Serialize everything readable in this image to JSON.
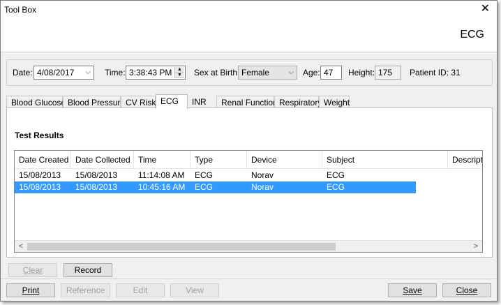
{
  "window": {
    "title": "Tool Box",
    "header_title": "ECG"
  },
  "patient": {
    "date_label": "Date:",
    "date_value": "4/08/2017",
    "time_label": "Time:",
    "time_value": "3:38:43 PM",
    "sex_label": "Sex at Birth:",
    "sex_value": "Female",
    "age_label": "Age:",
    "age_value": "47",
    "height_label": "Height:",
    "height_value": "175",
    "patient_id": "Patient ID: 31"
  },
  "tabs": [
    {
      "label": "Blood Glucose",
      "active": false
    },
    {
      "label": "Blood Pressure",
      "active": false
    },
    {
      "label": "CV Risk",
      "active": false
    },
    {
      "label": "ECG",
      "active": true
    },
    {
      "label": "INR",
      "active": false
    },
    {
      "label": "Renal Function",
      "active": false
    },
    {
      "label": "Respiratory",
      "active": false
    },
    {
      "label": "Weight",
      "active": false
    }
  ],
  "results": {
    "section_title": "Test Results",
    "columns": [
      "Date Created",
      "Date Collected",
      "Time",
      "Type",
      "Device",
      "Subject",
      "Descripti"
    ],
    "rows": [
      {
        "cells": [
          "15/08/2013",
          "15/08/2013",
          "11:14:08 AM",
          "ECG",
          "Norav",
          "ECG"
        ],
        "selected": false
      },
      {
        "cells": [
          "15/08/2013",
          "15/08/2013",
          "10:45:16 AM",
          "ECG",
          "Norav",
          "ECG"
        ],
        "selected": true
      }
    ]
  },
  "actions": {
    "clear": "Clear",
    "record": "Record"
  },
  "footer": {
    "print": "Print",
    "reference": "Reference",
    "edit": "Edit",
    "view": "View",
    "save": "Save",
    "close": "Close"
  },
  "colors": {
    "selection": "#3399ff",
    "window_bg": "#f0f0f0"
  }
}
